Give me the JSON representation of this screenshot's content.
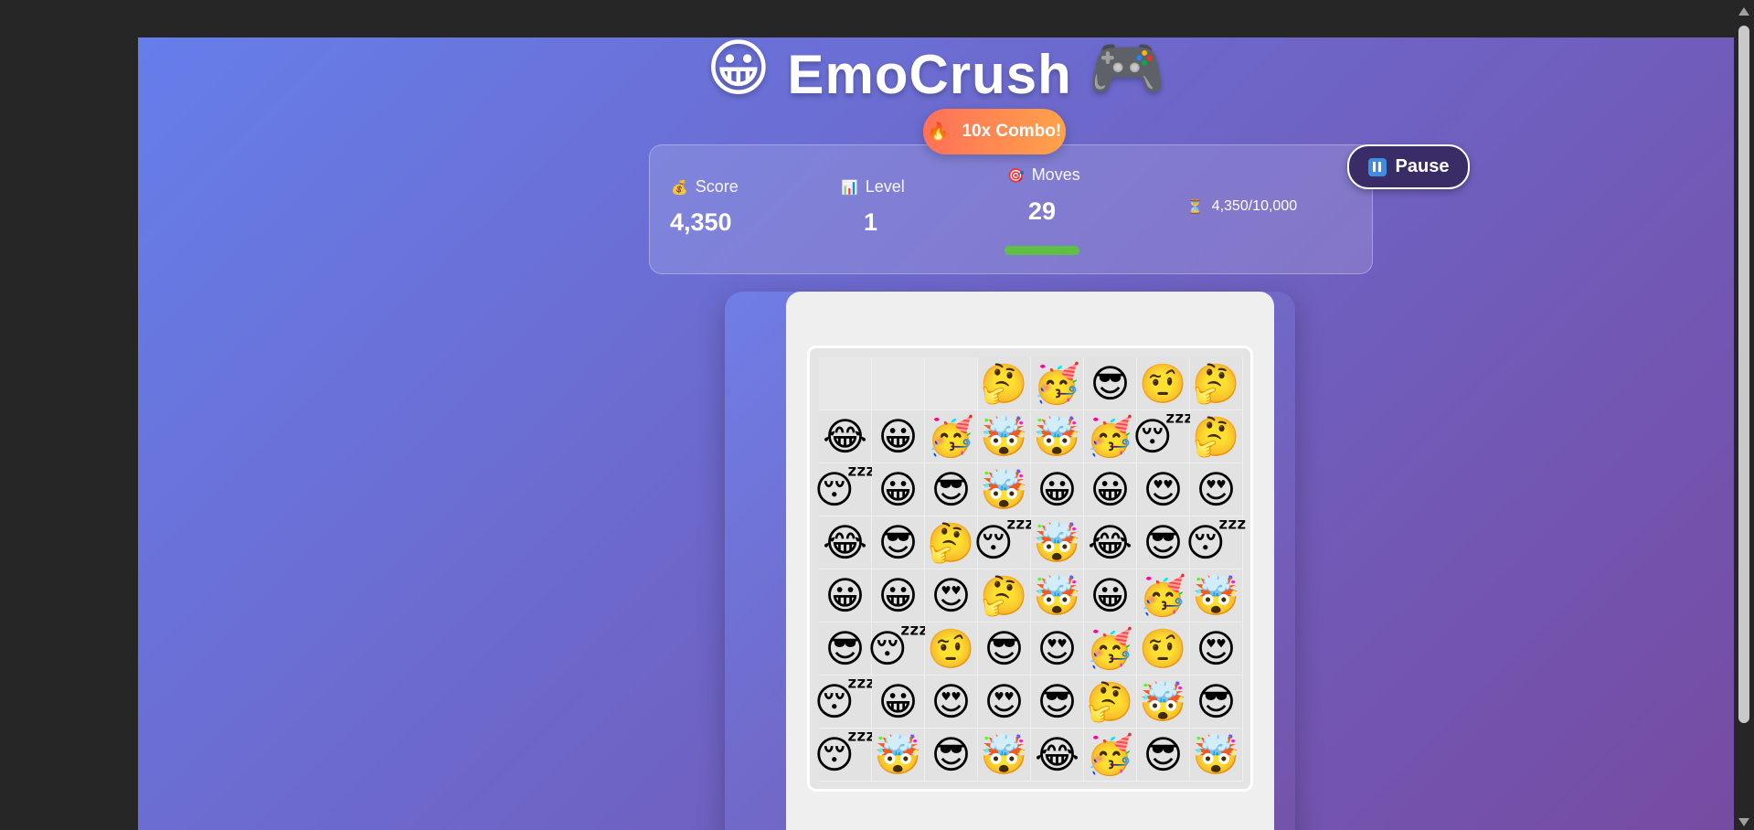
{
  "header": {
    "title": "EmoCrush",
    "left_emoji": "😀",
    "right_emoji": "🎮"
  },
  "combo": {
    "icon": "🔥",
    "text": "10x Combo!"
  },
  "stats": {
    "score": {
      "icon": "💰",
      "label": "Score",
      "value": "4,350"
    },
    "level": {
      "icon": "📊",
      "label": "Level",
      "value": "1"
    },
    "moves": {
      "icon": "🎯",
      "label": "Moves",
      "value": "29",
      "progress": 1.0
    },
    "target": {
      "icon": "⏳",
      "text": "4,350/10,000"
    }
  },
  "pause_button": {
    "label": "Pause",
    "icon": "pause-icon"
  },
  "board": {
    "rows": [
      [
        "",
        "",
        "",
        "🤔",
        "🥳",
        "😎",
        "🤨",
        "🤔"
      ],
      [
        "😂",
        "😀",
        "🥳",
        "🤯",
        "🤯",
        "🥳",
        "😴",
        "🤔"
      ],
      [
        "😴",
        "😀",
        "😎",
        "🤯",
        "😀",
        "😀",
        "😍",
        "😍"
      ],
      [
        "😂",
        "😎",
        "🤔",
        "😴",
        "🤯",
        "😂",
        "😎",
        "😴"
      ],
      [
        "😀",
        "😀",
        "😍",
        "🤔",
        "🤯",
        "😀",
        "🥳",
        "🤯"
      ],
      [
        "😎",
        "😴",
        "🤨",
        "😎",
        "😍",
        "🥳",
        "🤨",
        "😍"
      ],
      [
        "😴",
        "😀",
        "😍",
        "😍",
        "😎",
        "🤔",
        "🤯",
        "😎"
      ],
      [
        "😴",
        "🤯",
        "😎",
        "🤯",
        "😂",
        "🥳",
        "😎",
        "🤯"
      ]
    ]
  }
}
